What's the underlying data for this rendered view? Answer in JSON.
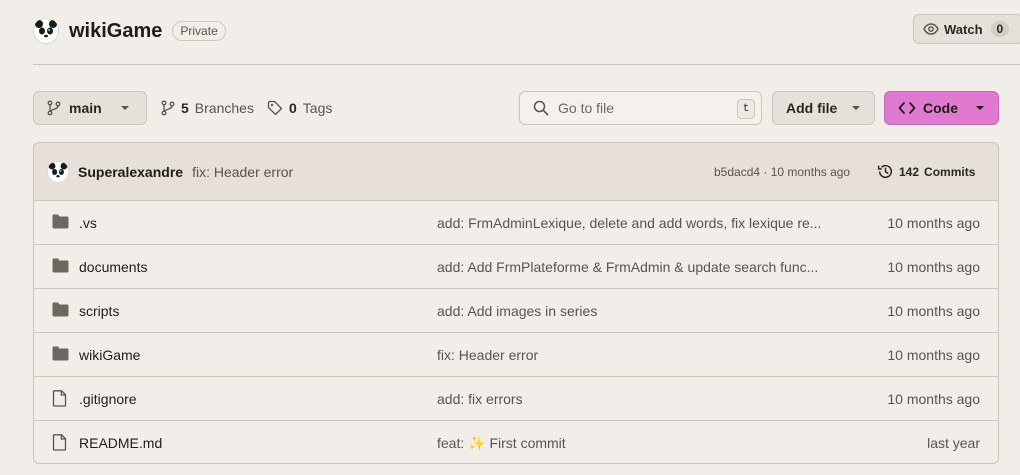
{
  "repo": {
    "name": "wikiGame",
    "visibility": "Private"
  },
  "watch": {
    "label": "Watch",
    "count": "0"
  },
  "toolbar": {
    "branch": "main",
    "branches_count": "5",
    "branches_label": "Branches",
    "tags_count": "0",
    "tags_label": "Tags",
    "search_placeholder": "Go to file",
    "search_shortcut": "t",
    "add_file_label": "Add file",
    "code_label": "Code"
  },
  "latest_commit": {
    "author": "Superalexandre",
    "message": "fix: Header error",
    "meta": "b5dacd4 · 10 months ago",
    "commits_count": "142",
    "commits_label": "Commits"
  },
  "files": [
    {
      "type": "folder",
      "name": ".vs",
      "commit_prefix": "add: FrmAdminLexique, delete and add words, fix lexique re...",
      "commit_emoji": "",
      "commit_suffix": "",
      "date": "10 months ago"
    },
    {
      "type": "folder",
      "name": "documents",
      "commit_prefix": "add: Add FrmPlateforme & FrmAdmin & update search func...",
      "commit_emoji": "",
      "commit_suffix": "",
      "date": "10 months ago"
    },
    {
      "type": "folder",
      "name": "scripts",
      "commit_prefix": "add: Add images in series",
      "commit_emoji": "",
      "commit_suffix": "",
      "date": "10 months ago"
    },
    {
      "type": "folder",
      "name": "wikiGame",
      "commit_prefix": "fix: Header error",
      "commit_emoji": "",
      "commit_suffix": "",
      "date": "10 months ago"
    },
    {
      "type": "file",
      "name": ".gitignore",
      "commit_prefix": "add: fix errors",
      "commit_emoji": "",
      "commit_suffix": "",
      "date": "10 months ago"
    },
    {
      "type": "file",
      "name": "README.md",
      "commit_prefix": "feat:",
      "commit_emoji": "✨",
      "commit_suffix": "First commit",
      "date": "last year"
    }
  ],
  "colors": {
    "background": "#f1eeea",
    "code_button": "#e07ad0",
    "border": "#cbc4ba"
  }
}
